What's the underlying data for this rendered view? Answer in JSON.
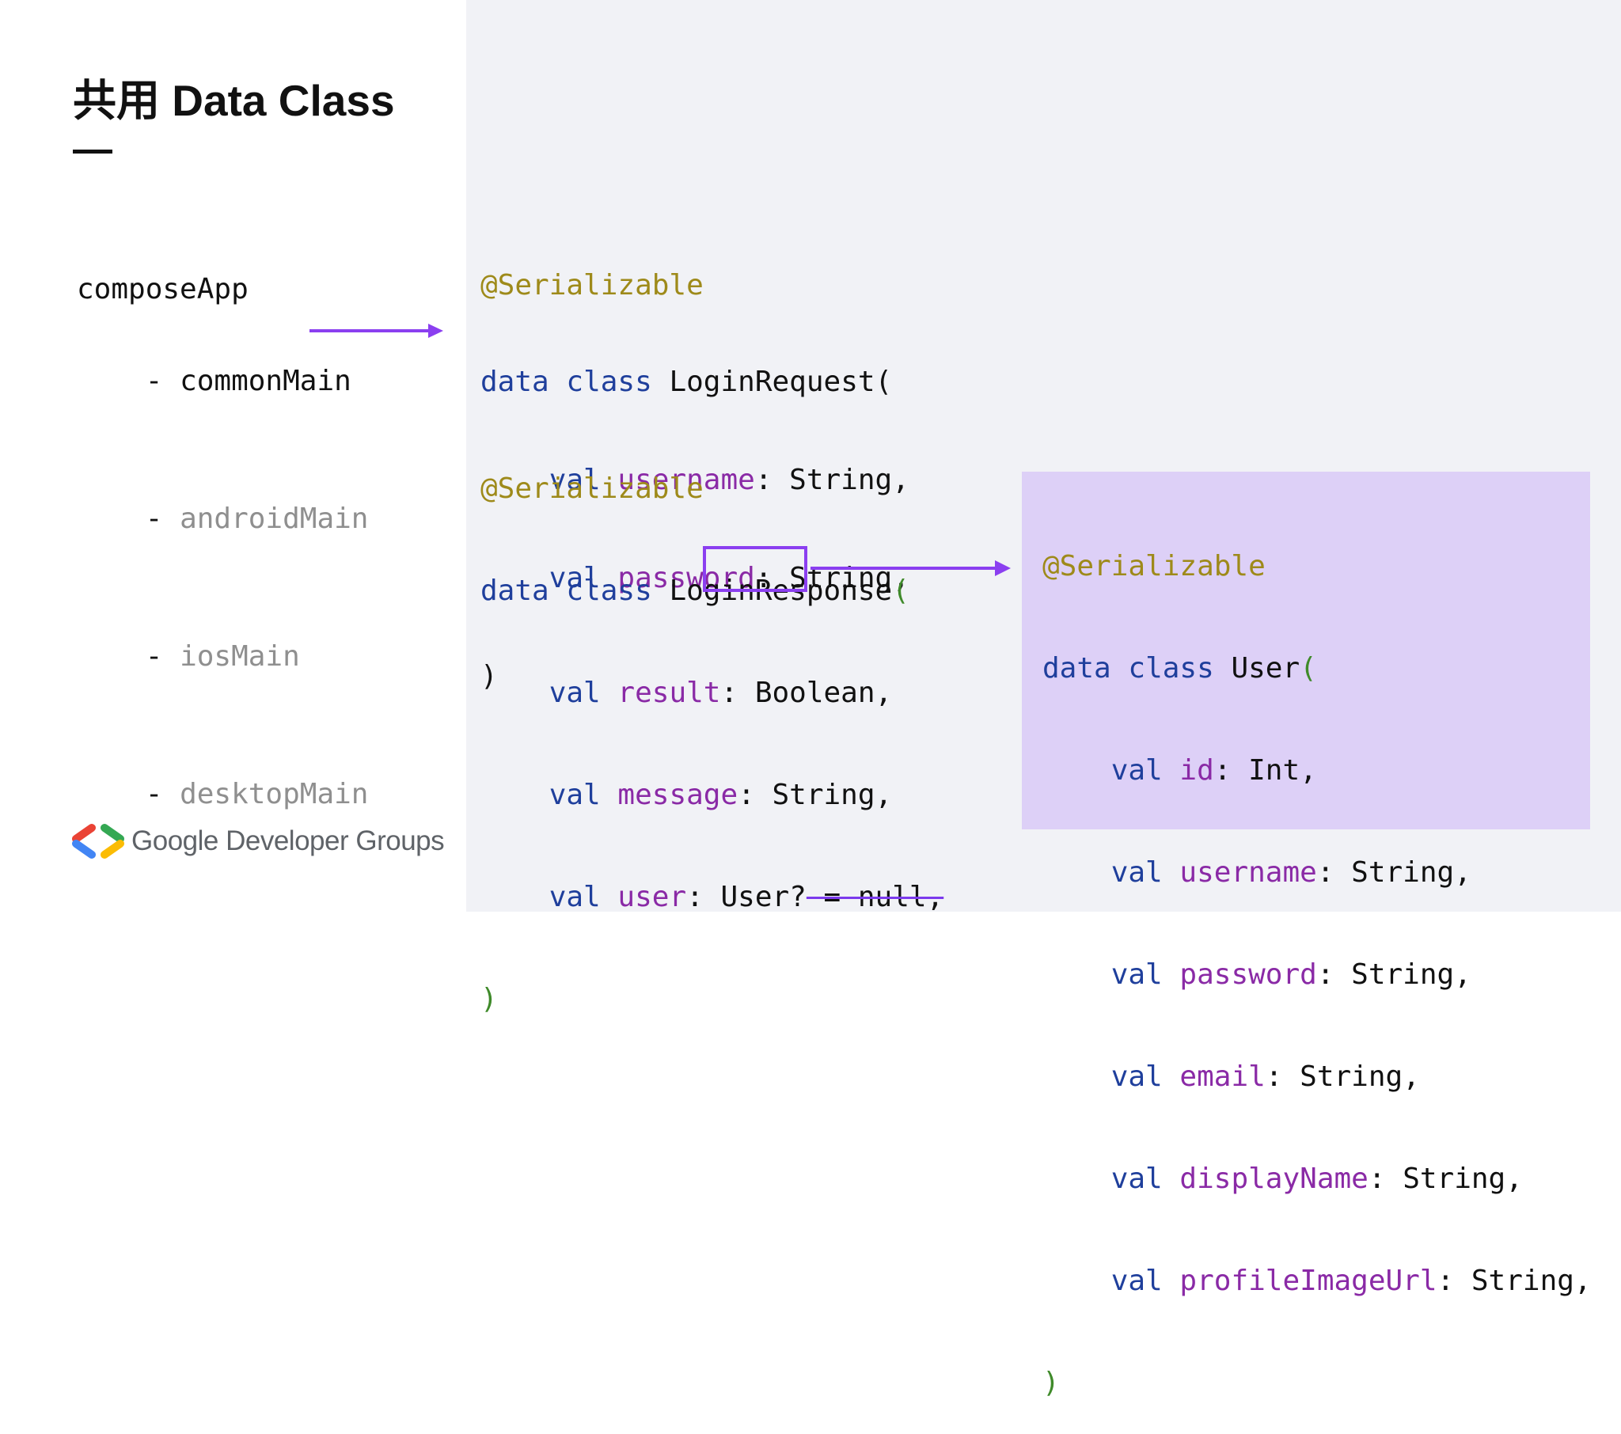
{
  "slide": {
    "title": "共用 Data Class"
  },
  "tree": {
    "root": "composeApp",
    "items": [
      {
        "dash": "- ",
        "label": "commonMain",
        "state": "active"
      },
      {
        "dash": "- ",
        "label": "androidMain",
        "state": "dim"
      },
      {
        "dash": "- ",
        "label": "iosMain",
        "state": "dim"
      },
      {
        "dash": "- ",
        "label": "desktopMain",
        "state": "dim"
      }
    ]
  },
  "code": {
    "login_request": {
      "annotation": "@Serializable",
      "kw_data": "data",
      "kw_class": "class",
      "name": "LoginRequest",
      "open_paren": "(",
      "fields": [
        {
          "kw": "val",
          "name": "username",
          "type": ": String,"
        },
        {
          "kw": "val",
          "name": "password",
          "type": ": String,"
        }
      ],
      "close_paren": ")"
    },
    "login_response": {
      "annotation": "@Serializable",
      "kw_data": "data",
      "kw_class": "class",
      "name": "LoginResponse",
      "open_paren": "(",
      "fields": [
        {
          "kw": "val",
          "name": "result",
          "type": ": Boolean,"
        },
        {
          "kw": "val",
          "name": "message",
          "type": ": String,"
        }
      ],
      "user_field": {
        "kw": "val",
        "name": "user",
        "colon": ": ",
        "type": "User?",
        "default": " = null,"
      },
      "close_paren": ")"
    },
    "user": {
      "annotation": "@Serializable",
      "kw_data": "data",
      "kw_class": "class",
      "name": "User",
      "open_paren": "(",
      "fields": [
        {
          "kw": "val",
          "name": "id",
          "type": ": Int,"
        },
        {
          "kw": "val",
          "name": "username",
          "type": ": String,"
        },
        {
          "kw": "val",
          "name": "password",
          "type": ": String,"
        },
        {
          "kw": "val",
          "name": "email",
          "type": ": String,"
        },
        {
          "kw": "val",
          "name": "displayName",
          "type": ": String,"
        },
        {
          "kw": "val",
          "name": "profileImageUrl",
          "type": ": String,"
        }
      ],
      "close_paren": ")"
    }
  },
  "branding": {
    "name": "Google Developer Groups",
    "logo_icon": "gdg-brackets-icon"
  },
  "colors": {
    "annotation": "#9e8a1a",
    "keyword": "#1f3f9c",
    "property": "#8a2aa6",
    "arrow": "#8b3ff0",
    "user_panel_bg": "#ddd0f7",
    "code_area_bg": "#f1f2f6"
  }
}
